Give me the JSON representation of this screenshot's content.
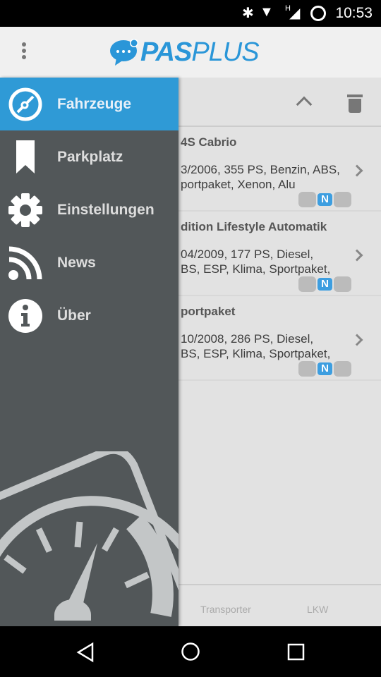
{
  "status_bar": {
    "time": "10:53",
    "network": "H",
    "icons": [
      "bluetooth-icon",
      "wifi-alert-icon",
      "signal-icon",
      "sync-icon"
    ]
  },
  "app_bar": {
    "logo_bold": "PAS",
    "logo_light": "PLUS",
    "brand_color": "#2a96d8"
  },
  "drawer": {
    "items": [
      {
        "label": "Fahrzeuge",
        "icon": "speedometer-icon",
        "active": true
      },
      {
        "label": "Parkplatz",
        "icon": "bookmark-icon"
      },
      {
        "label": "Einstellungen",
        "icon": "gear-icon"
      },
      {
        "label": "News",
        "icon": "rss-icon"
      },
      {
        "label": "Über",
        "icon": "info-icon"
      }
    ],
    "active_color": "#2f9ad6"
  },
  "vehicles": [
    {
      "title": "4S Cabrio",
      "desc": "3/2006, 355 PS, Benzin, ABS,\nportpaket, Xenon, Alu",
      "badge": "N"
    },
    {
      "title": "dition Lifestyle Automatik",
      "desc": "04/2009, 177 PS, Diesel,\nBS, ESP, Klima, Sportpaket,",
      "badge": "N"
    },
    {
      "title": "portpaket",
      "desc": "10/2008, 286 PS, Diesel,\nBS, ESP, Klima, Sportpaket,",
      "badge": "N"
    }
  ],
  "tabs": [
    "Transporter",
    "LKW"
  ]
}
